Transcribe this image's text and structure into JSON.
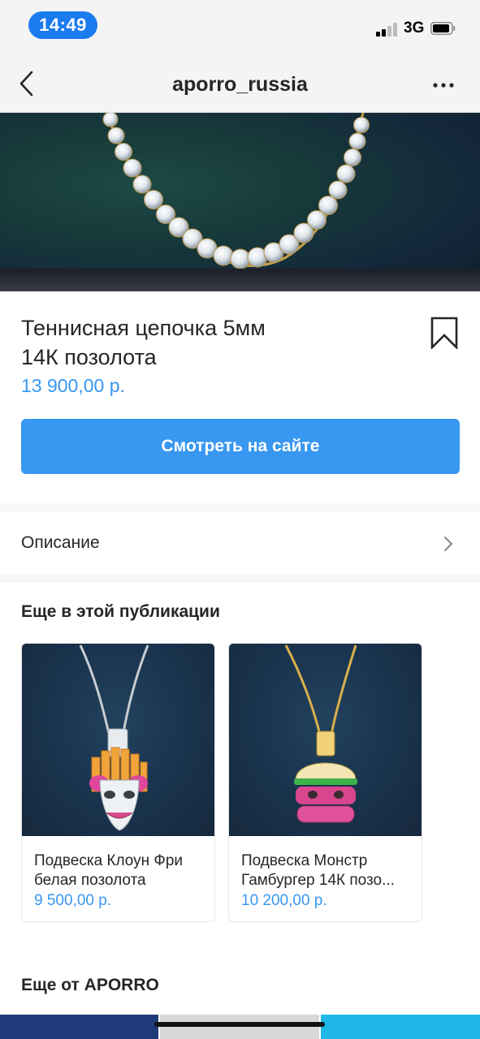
{
  "status_bar": {
    "time": "14:49",
    "network": "3G"
  },
  "nav": {
    "title": "aporro_russia",
    "back_icon": "chevron-left-icon",
    "more_icon": "more-horizontal-icon"
  },
  "product": {
    "title_line1": "Теннисная цепочка 5мм",
    "title_line2": "14К позолота",
    "price": "13 900,00 р.",
    "cta_label": "Смотреть на сайте",
    "bookmark_icon": "bookmark-icon"
  },
  "description": {
    "label": "Описание",
    "icon": "chevron-right-icon"
  },
  "more_in_post": {
    "title": "Еще в этой публикации",
    "items": [
      {
        "name_line1": "Подвеска Клоун Фри",
        "name_line2": "белая позолота",
        "price": "9 500,00 р."
      },
      {
        "name_line1": "Подвеска Монстр",
        "name_line2": "Гамбургер 14К позо...",
        "price": "10 200,00 р."
      }
    ]
  },
  "more_from": {
    "title": "Еще от APORRO"
  },
  "colors": {
    "accent": "#3897f0",
    "time_pill": "#1b7cf0",
    "text": "#262626"
  }
}
